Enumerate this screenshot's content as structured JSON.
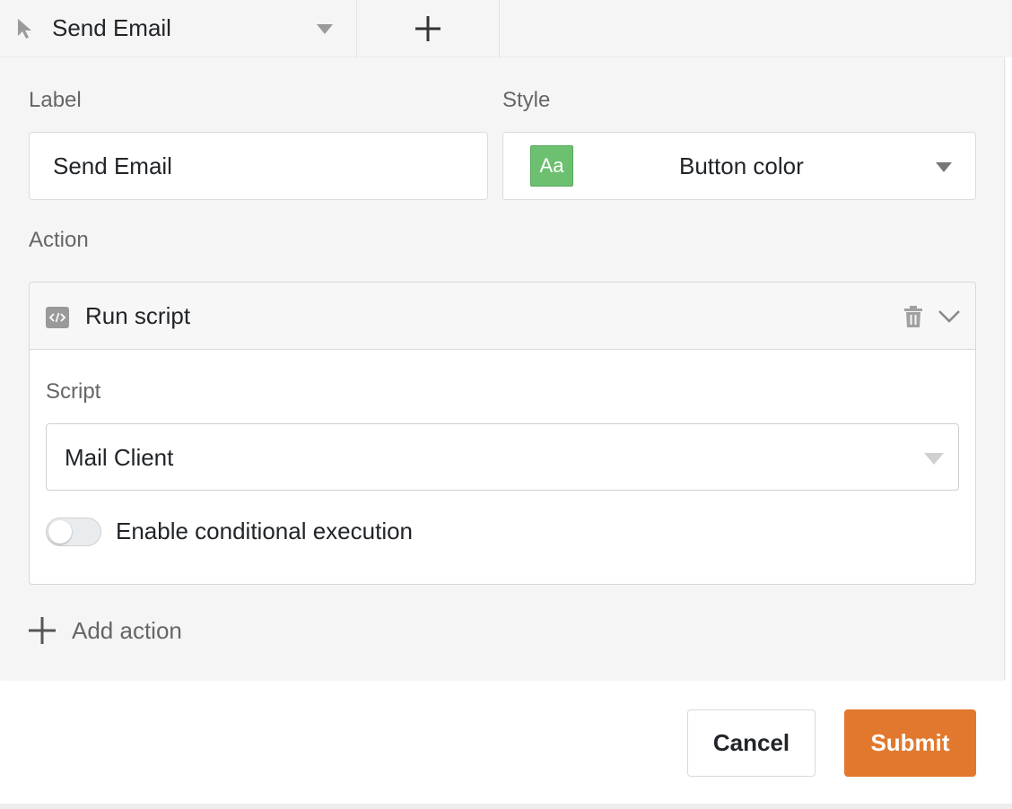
{
  "tabs": {
    "active_label": "Send Email",
    "add_icon": "plus-icon",
    "cursor_icon": "cursor-arrow-icon"
  },
  "form": {
    "label_heading": "Label",
    "label_value": "Send Email",
    "style_heading": "Style",
    "style_swatch_text": "Aa",
    "style_value": "Button color",
    "style_swatch_color": "#6cc070",
    "action_heading": "Action"
  },
  "action": {
    "type_label": "Run script",
    "script_heading": "Script",
    "script_value": "Mail Client",
    "toggle_label": "Enable conditional execution",
    "toggle_on": false
  },
  "add_action_label": "Add action",
  "buttons": {
    "cancel_label": "Cancel",
    "submit_label": "Submit",
    "submit_color": "#e2782d"
  }
}
